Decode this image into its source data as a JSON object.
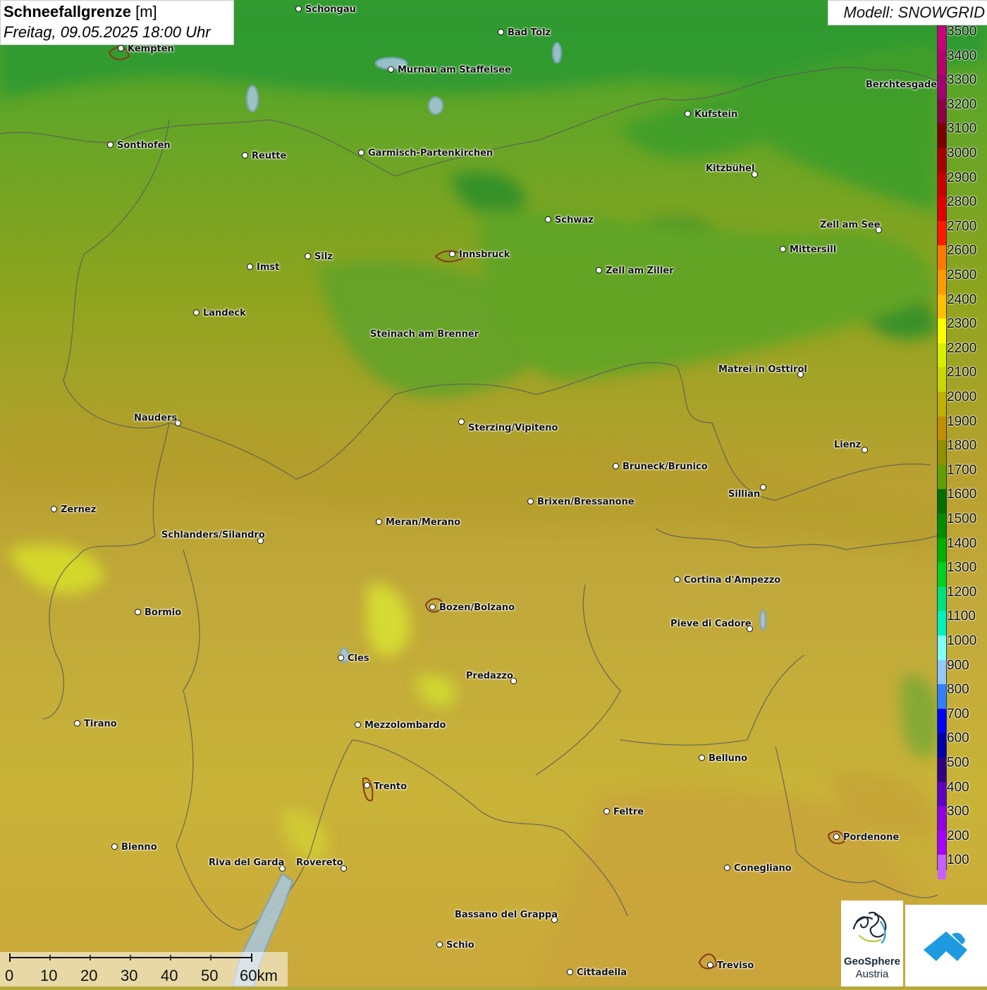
{
  "header": {
    "title_bold": "Schneefallgrenze",
    "title_unit": "[m]",
    "datetime": "Freitag, 09.05.2025 18:00 Uhr"
  },
  "model": {
    "label": "Modell: SNOWGRID"
  },
  "legend": {
    "levels": [
      {
        "label": "3500",
        "color": "#c8007a"
      },
      {
        "label": "3400",
        "color": "#b6006e"
      },
      {
        "label": "3300",
        "color": "#a00070"
      },
      {
        "label": "3200",
        "color": "#8b0048"
      },
      {
        "label": "3100",
        "color": "#7a0000"
      },
      {
        "label": "3000",
        "color": "#a80000"
      },
      {
        "label": "2900",
        "color": "#c80000"
      },
      {
        "label": "2800",
        "color": "#e00000"
      },
      {
        "label": "2700",
        "color": "#ff1a00"
      },
      {
        "label": "2600",
        "color": "#ff7a00"
      },
      {
        "label": "2500",
        "color": "#ff9a00"
      },
      {
        "label": "2400",
        "color": "#ffc000"
      },
      {
        "label": "2300",
        "color": "#ffff00"
      },
      {
        "label": "2200",
        "color": "#d8f000"
      },
      {
        "label": "2100",
        "color": "#c8d800"
      },
      {
        "label": "2000",
        "color": "#c0b000"
      },
      {
        "label": "1900",
        "color": "#c09000"
      },
      {
        "label": "1800",
        "color": "#909000"
      },
      {
        "label": "1700",
        "color": "#60a000"
      },
      {
        "label": "1600",
        "color": "#007000"
      },
      {
        "label": "1500",
        "color": "#008c00"
      },
      {
        "label": "1400",
        "color": "#00b000"
      },
      {
        "label": "1300",
        "color": "#00d020"
      },
      {
        "label": "1200",
        "color": "#00e080"
      },
      {
        "label": "1100",
        "color": "#00f0c0"
      },
      {
        "label": "1000",
        "color": "#80ffff"
      },
      {
        "label": "900",
        "color": "#90c8ff"
      },
      {
        "label": "800",
        "color": "#3080ff"
      },
      {
        "label": "700",
        "color": "#0000ff"
      },
      {
        "label": "600",
        "color": "#0000a8"
      },
      {
        "label": "500",
        "color": "#300080"
      },
      {
        "label": "400",
        "color": "#6000c0"
      },
      {
        "label": "300",
        "color": "#9000e0"
      },
      {
        "label": "200",
        "color": "#a800ff"
      },
      {
        "label": "100",
        "color": "#c860ff"
      }
    ]
  },
  "scale": {
    "ticks": [
      "0",
      "10",
      "20",
      "30",
      "40",
      "50",
      "60km"
    ]
  },
  "logos": {
    "geosphere_line1": "GeoSphere",
    "geosphere_line2": "Austria"
  },
  "cities": [
    {
      "name": "Schongau"
    },
    {
      "name": "Bad Tölz"
    },
    {
      "name": "Kempten"
    },
    {
      "name": "Murnau am Staffelsee"
    },
    {
      "name": "Berchtesgaden"
    },
    {
      "name": "Kufstein"
    },
    {
      "name": "Sonthofen"
    },
    {
      "name": "Reutte"
    },
    {
      "name": "Garmisch-Partenkirchen"
    },
    {
      "name": "Kitzbühel"
    },
    {
      "name": "Schwaz"
    },
    {
      "name": "Zell am See"
    },
    {
      "name": "Mittersill"
    },
    {
      "name": "Innsbruck"
    },
    {
      "name": "Silz"
    },
    {
      "name": "Imst"
    },
    {
      "name": "Zell am Ziller"
    },
    {
      "name": "Landeck"
    },
    {
      "name": "Steinach am Brenner"
    },
    {
      "name": "Matrei in Osttirol"
    },
    {
      "name": "Nauders"
    },
    {
      "name": "Sterzing/Vipiteno"
    },
    {
      "name": "Lienz"
    },
    {
      "name": "Bruneck/Brunico"
    },
    {
      "name": "Sillian"
    },
    {
      "name": "Brixen/Bressanone"
    },
    {
      "name": "Zernez"
    },
    {
      "name": "Meran/Merano"
    },
    {
      "name": "Schlanders/Silandro"
    },
    {
      "name": "Cortina d'Ampezzo"
    },
    {
      "name": "Bozen/Bolzano"
    },
    {
      "name": "Bormio"
    },
    {
      "name": "Pieve di Cadore"
    },
    {
      "name": "Cles"
    },
    {
      "name": "Predazzo"
    },
    {
      "name": "Tirano"
    },
    {
      "name": "Mezzolombardo"
    },
    {
      "name": "Belluno"
    },
    {
      "name": "Trento"
    },
    {
      "name": "Feltre"
    },
    {
      "name": "Pordenone"
    },
    {
      "name": "Bienno"
    },
    {
      "name": "Riva del Garda"
    },
    {
      "name": "Rovereto"
    },
    {
      "name": "Conegliano"
    },
    {
      "name": "Bassano del Grappa"
    },
    {
      "name": "Schio"
    },
    {
      "name": "Treviso"
    },
    {
      "name": "Cittadella"
    }
  ]
}
